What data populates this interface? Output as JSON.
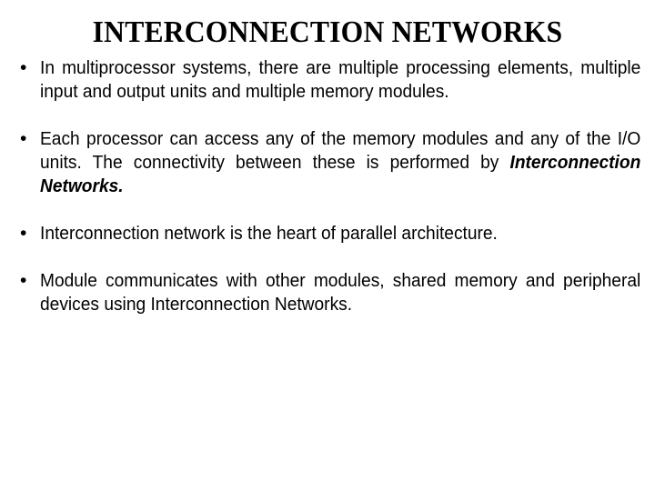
{
  "slide": {
    "title": "INTERCONNECTION NETWORKS",
    "background_color": "#FFFFFF",
    "text_color": "#000000",
    "bullet_marker": "•",
    "bullets": [
      {
        "id": "bullet-multiprocessor-systems",
        "text": "In multiprocessor systems, there are multiple processing elements, multiple input and output units and multiple memory modules.",
        "emphasis": ""
      },
      {
        "id": "bullet-processor-access",
        "text": "Each processor can access any of the memory modules and any of the I/O units. The connectivity between these is performed by ",
        "emphasis": "Interconnection Networks."
      },
      {
        "id": "bullet-heart-of-parallel-architecture",
        "text": "Interconnection network is the heart of parallel architecture.",
        "emphasis": ""
      },
      {
        "id": "bullet-module-communicates",
        "text": "Module communicates with other modules, shared memory and peripheral devices using Interconnection Networks.",
        "emphasis": ""
      }
    ]
  }
}
